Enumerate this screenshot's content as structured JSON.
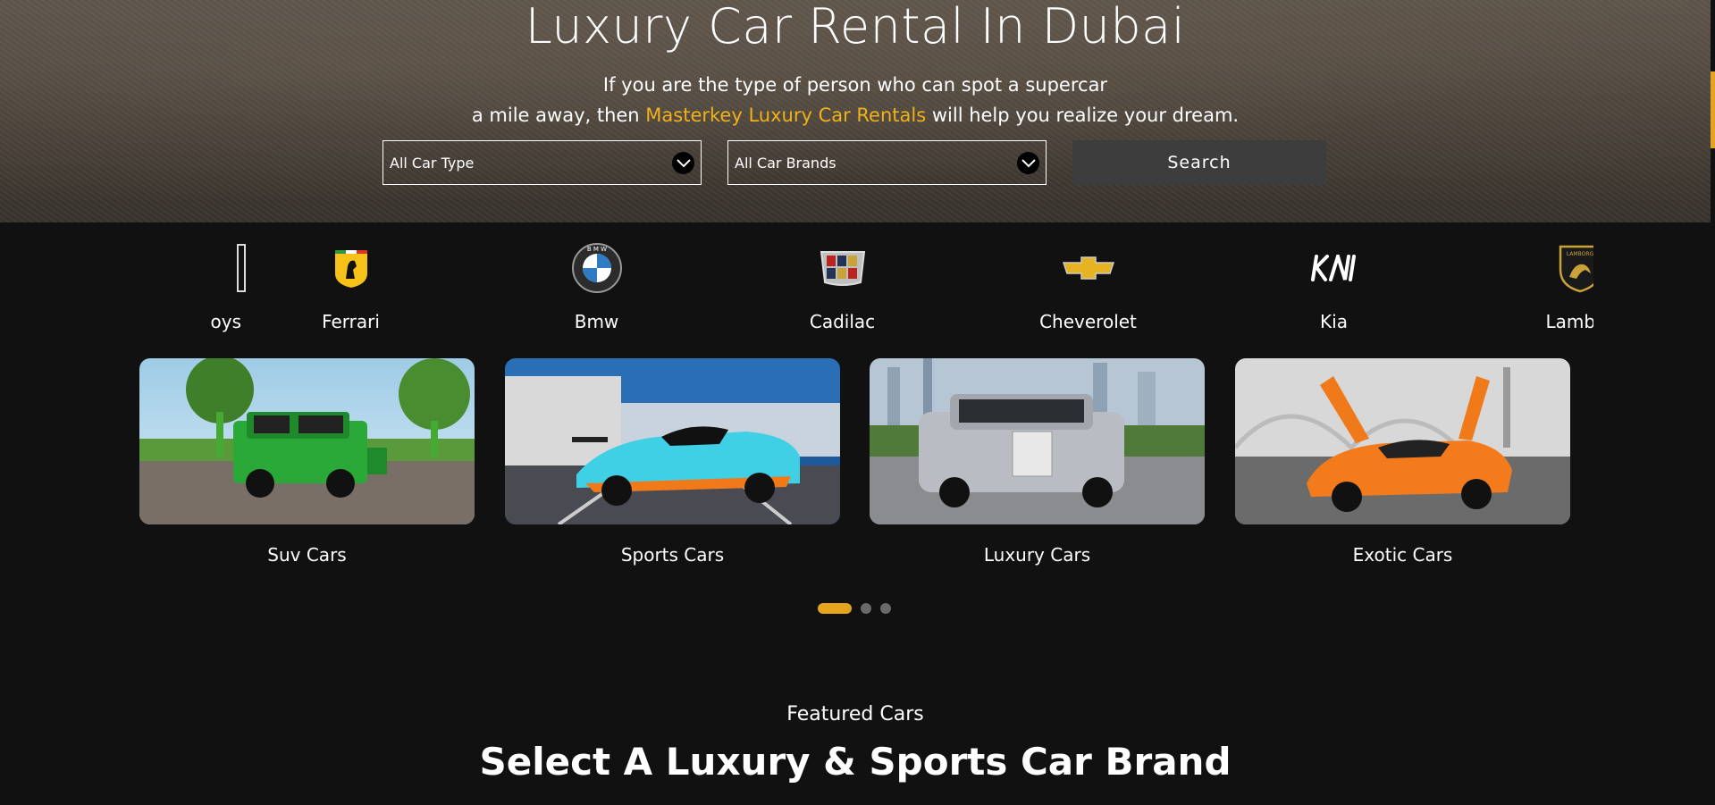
{
  "hero": {
    "title": "Luxury Car Rental In Dubai",
    "subtitle_line1": "If you are the type of person who can spot a supercar",
    "subtitle_line2_pre": "a mile away, then ",
    "subtitle_line2_accent": "Masterkey Luxury Car Rentals",
    "subtitle_line2_post": " will help you realize your dream."
  },
  "filters": {
    "car_type": "All Car Type",
    "car_brand": "All Car Brands",
    "search_label": "Search"
  },
  "brands": [
    {
      "name": "oys",
      "icon": "rolls-royce-logo-icon"
    },
    {
      "name": "Ferrari",
      "icon": "ferrari-logo-icon"
    },
    {
      "name": "Bmw",
      "icon": "bmw-logo-icon"
    },
    {
      "name": "Cadilac",
      "icon": "cadillac-logo-icon"
    },
    {
      "name": "Cheverolet",
      "icon": "chevrolet-logo-icon"
    },
    {
      "name": "Kia",
      "icon": "kia-logo-icon"
    },
    {
      "name": "Lambor",
      "icon": "lamborghini-logo-icon"
    }
  ],
  "categories": [
    {
      "title": "Suv Cars",
      "image": "green-suv-image"
    },
    {
      "title": "Sports Cars",
      "image": "blue-sports-car-image"
    },
    {
      "title": "Luxury Cars",
      "image": "silver-luxury-car-image"
    },
    {
      "title": "Exotic Cars",
      "image": "orange-exotic-car-image"
    }
  ],
  "carousel": {
    "pages": 3,
    "active": 1
  },
  "featured": {
    "label": "Featured Cars",
    "heading": "Select A Luxury & Sports Car Brand"
  },
  "colors": {
    "accent": "#f0b21a",
    "background": "#111111",
    "button": "#3d3d3d"
  }
}
